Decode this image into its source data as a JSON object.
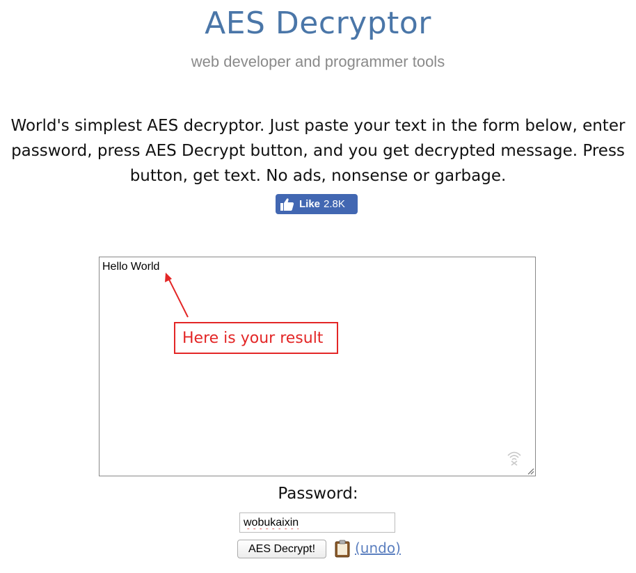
{
  "header": {
    "title": "AES Decryptor",
    "subtitle": "web developer and programmer tools"
  },
  "intro": {
    "text": "World's simplest AES decryptor. Just paste your text in the form below, enter password, press AES Decrypt button, and you get decrypted message. Press button, get text. No ads, nonsense or garbage."
  },
  "like_button": {
    "label": "Like",
    "count": "2.8K",
    "color": "#4267b2",
    "icon": "thumbs-up-icon"
  },
  "editor": {
    "value": "Hello World"
  },
  "annotation": {
    "text": "Here is your result",
    "color": "#e32626"
  },
  "form": {
    "password_label": "Password:",
    "password_value": "wobukaixin",
    "decrypt_button": "AES Decrypt!",
    "undo_link": "(undo)",
    "clipboard_icon": "clipboard-icon"
  }
}
